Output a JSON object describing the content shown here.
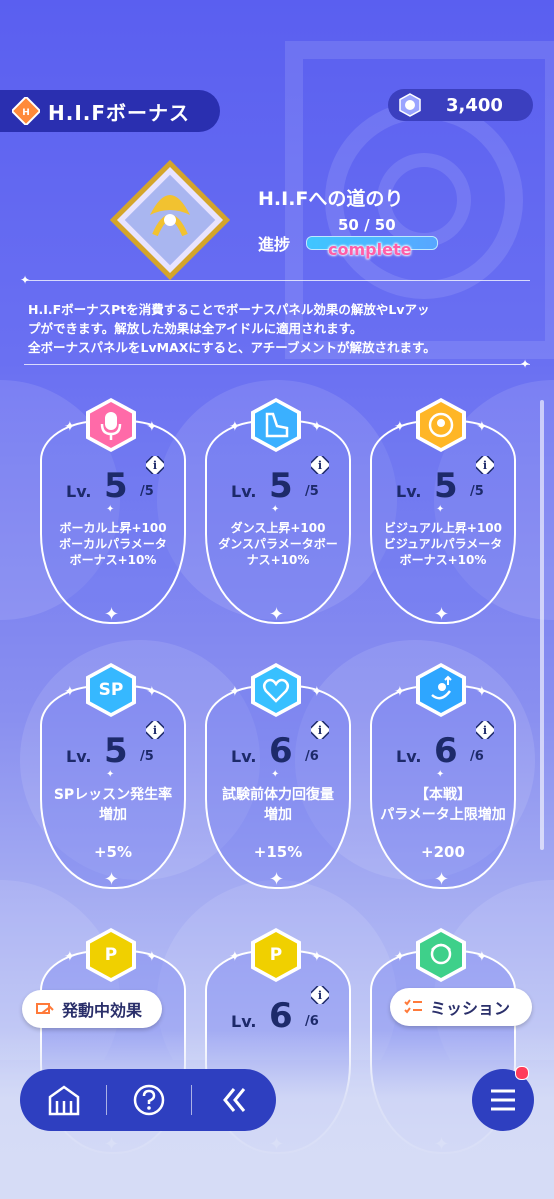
{
  "header": {
    "title": "H.I.Fボーナス",
    "currency_value": "3,400",
    "currency_icon": "hif-coin-icon"
  },
  "road": {
    "title": "H.I.Fへの道のり",
    "progress_label": "進捗",
    "progress_count": "50 / 50",
    "progress_status": "complete",
    "progress_fraction": 1.0
  },
  "description": [
    "H.I.FボーナスPtを消費することでボーナスパネル効果の解放やLvアッ",
    "プができます。解放した効果は全アイドルに適用されます。",
    "全ボーナスパネルをLvMAXにすると、アチーブメントが解放されます。"
  ],
  "panels": [
    {
      "icon": "microphone-icon",
      "color": "#ff6aa8",
      "lv_label": "Lv.",
      "lv": "5",
      "max": "/5",
      "desc": [
        "ボーカル上昇+100",
        "ボーカルパラメータ",
        "ボーナス+10%"
      ],
      "value": ""
    },
    {
      "icon": "dance-shoe-icon",
      "color": "#3ab0ff",
      "lv_label": "Lv.",
      "lv": "5",
      "max": "/5",
      "desc": [
        "ダンス上昇+100",
        "ダンスパラメータボー",
        "ナス+10%"
      ],
      "value": ""
    },
    {
      "icon": "visual-icon",
      "color": "#ffb626",
      "lv_label": "Lv.",
      "lv": "5",
      "max": "/5",
      "desc": [
        "ビジュアル上昇+100",
        "ビジュアルパラメータ",
        "ボーナス+10%"
      ],
      "value": ""
    },
    {
      "icon": "sp-icon",
      "icon_text": "SP",
      "color": "#36b8ff",
      "lv_label": "Lv.",
      "lv": "5",
      "max": "/5",
      "desc": [
        "SPレッスン発生率",
        "増加"
      ],
      "value": "+5%"
    },
    {
      "icon": "heart-icon",
      "color": "#38c0ff",
      "lv_label": "Lv.",
      "lv": "6",
      "max": "/6",
      "desc": [
        "試験前体力回復量",
        "増加"
      ],
      "value": "+15%"
    },
    {
      "icon": "parameter-up-icon",
      "color": "#2ea6ff",
      "lv_label": "Lv.",
      "lv": "6",
      "max": "/6",
      "desc": [
        "【本戦】",
        "パラメータ上限増加"
      ],
      "value": "+200"
    },
    {
      "icon": "p-coin-icon",
      "icon_text": "P",
      "color": "#f0d000",
      "lv_label": "",
      "lv": "",
      "max": "",
      "desc": [],
      "value": ""
    },
    {
      "icon": "p-coin-icon",
      "icon_text": "P",
      "color": "#f0d000",
      "lv_label": "Lv.",
      "lv": "6",
      "max": "/6",
      "desc": [],
      "value": ""
    },
    {
      "icon": "idol-face-icon",
      "color": "#3ed08a",
      "lv_label": "",
      "lv": "",
      "max": "",
      "desc": [],
      "value": ""
    }
  ],
  "floating": {
    "active_effects": "発動中効果",
    "mission": "ミッション"
  },
  "nav": {
    "home_icon": "home-icon",
    "help_icon": "help-icon",
    "back_icon": "back-icon",
    "menu_icon": "menu-icon"
  }
}
